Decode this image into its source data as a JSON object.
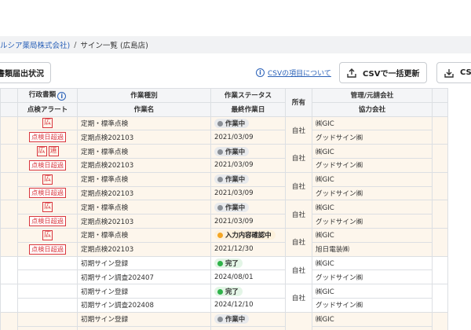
{
  "breadcrumb": {
    "parent": "ルシア薬局株式会社)",
    "separator": "/",
    "current": "サイン一覧 (広島店)"
  },
  "toolbar": {
    "left_button": "書類届出状況",
    "csv_info_link": "CSVの項目について",
    "csv_update_button": "CSVで一括更新",
    "csv_download_button": "CSV"
  },
  "table": {
    "headers_top": [
      "",
      "行政書類",
      "作業種別",
      "作業ステータス",
      "所有",
      "管理/元請会社",
      ""
    ],
    "headers_bottom": [
      "",
      "点検アラート",
      "作業名",
      "最終作業日",
      "",
      "協力会社",
      ""
    ],
    "rows": [
      {
        "kind": "warn",
        "badges": [
          "広"
        ],
        "alert": "点検日超過",
        "type": "定期・標準点検",
        "name": "定期点検202103",
        "status": "作業中",
        "status_kind": "working",
        "date": "2021/03/09",
        "owner": "自社",
        "mgmt": "㈱GIC",
        "partner": "グッドサイン㈱"
      },
      {
        "kind": "warn",
        "badges": [
          "広",
          "道"
        ],
        "alert": "点検日超過",
        "type": "定期・標準点検",
        "name": "定期点検202103",
        "status": "作業中",
        "status_kind": "working",
        "date": "2021/03/09",
        "owner": "自社",
        "mgmt": "㈱GIC",
        "partner": "グッドサイン㈱"
      },
      {
        "kind": "warn",
        "badges": [
          "広"
        ],
        "alert": "点検日超過",
        "type": "定期・標準点検",
        "name": "定期点検202103",
        "status": "作業中",
        "status_kind": "working",
        "date": "2021/03/09",
        "owner": "自社",
        "mgmt": "㈱GIC",
        "partner": "グッドサイン㈱"
      },
      {
        "kind": "warn",
        "badges": [
          "広"
        ],
        "alert": "点検日超過",
        "type": "定期・標準点検",
        "name": "定期点検202103",
        "status": "作業中",
        "status_kind": "working",
        "date": "2021/03/09",
        "owner": "自社",
        "mgmt": "㈱GIC",
        "partner": "グッドサイン㈱"
      },
      {
        "kind": "warn",
        "badges": [
          "広"
        ],
        "alert": "点検日超過",
        "type": "定期・標準点検",
        "name": "定期点検202103",
        "status": "入力内容確認中",
        "status_kind": "review",
        "date": "2021/12/30",
        "owner": "自社",
        "mgmt": "㈱GIC",
        "partner": "旭日電装㈱"
      },
      {
        "kind": "plain",
        "badges": [],
        "alert": "",
        "type": "初期サイン登録",
        "name": "初期サイン調査202407",
        "status": "完了",
        "status_kind": "done",
        "date": "2024/08/01",
        "owner": "自社",
        "mgmt": "㈱GIC",
        "partner": "グッドサイン㈱"
      },
      {
        "kind": "plain",
        "badges": [],
        "alert": "",
        "type": "初期サイン登録",
        "name": "初期サイン調査202408",
        "status": "完了",
        "status_kind": "done",
        "date": "2024/12/10",
        "owner": "自社",
        "mgmt": "㈱GIC",
        "partner": "グッドサイン㈱"
      },
      {
        "kind": "warn",
        "badges": [],
        "alert": "",
        "type": "初期サイン登録",
        "name": "",
        "status": "作業中",
        "status_kind": "working",
        "date": "",
        "owner": "",
        "mgmt": "㈱GIC",
        "partner": ""
      }
    ]
  },
  "colors": {
    "link": "#2a61b8",
    "alert_red": "#d9363e",
    "status_working_dot": "#8a8f96",
    "status_done_dot": "#2fb34a",
    "status_review_dot": "#f5a623",
    "warn_row_bg": "#fdf6ec"
  }
}
